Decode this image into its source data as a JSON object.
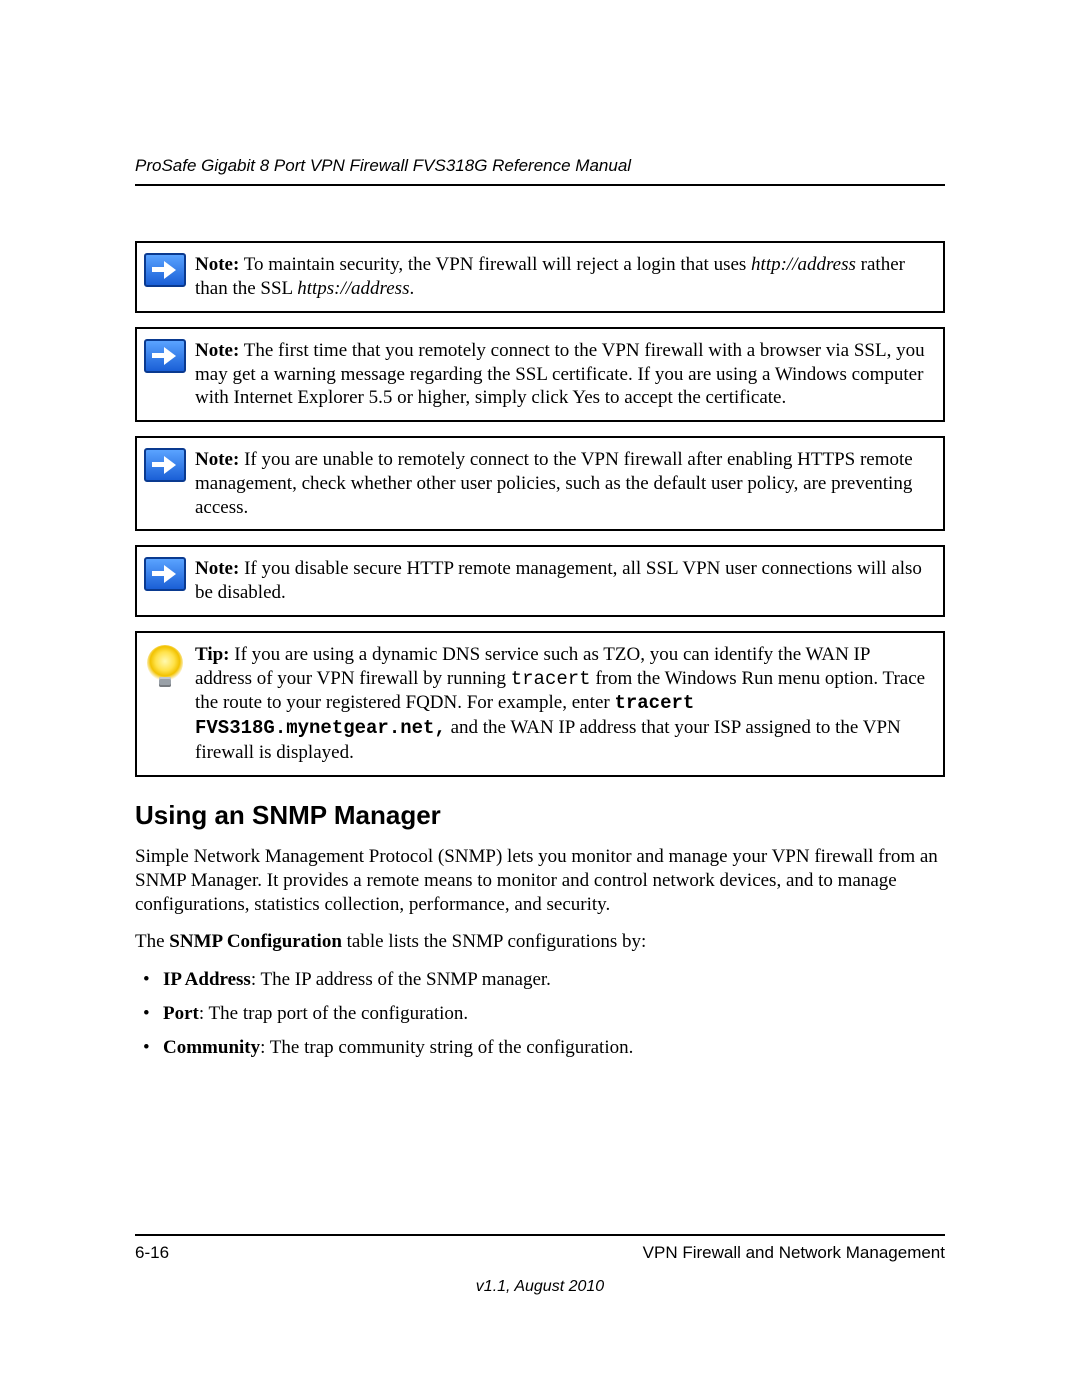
{
  "header": {
    "title": "ProSafe Gigabit 8 Port VPN Firewall FVS318G Reference Manual"
  },
  "notes": [
    {
      "label": "Note:",
      "pre": " To maintain security, the VPN firewall will reject a login that uses ",
      "ital1": "http://address",
      "mid": " rather than the SSL ",
      "ital2": "https://address",
      "post": "."
    },
    {
      "label": "Note:",
      "text": " The first time that you remotely connect to the VPN firewall with a browser via SSL, you may get a warning message regarding the SSL certificate. If you are using a Windows computer with Internet Explorer 5.5 or higher, simply click Yes to accept the certificate."
    },
    {
      "label": "Note:",
      "text": " If you are unable to remotely connect to the VPN firewall after enabling HTTPS remote management, check whether other user policies, such as the default user policy, are preventing access."
    },
    {
      "label": "Note:",
      "text": " If you disable secure HTTP remote management, all SSL VPN user connections will also be disabled."
    }
  ],
  "tip": {
    "label": "Tip:",
    "pre": " If you are using a dynamic DNS service such as TZO, you can identify the WAN IP address of your VPN firewall by running ",
    "mono1": "tracert",
    "mid": " from the Windows Run menu option. Trace the route to your registered FQDN. For example, enter ",
    "monob": "tracert FVS318G.mynetgear.net,",
    "post": " and the WAN IP address that your ISP assigned to the VPN firewall is displayed."
  },
  "section": {
    "heading": "Using an SNMP Manager",
    "para1": "Simple Network Management Protocol (SNMP) lets you monitor and manage your VPN firewall from an SNMP Manager. It provides a remote means to monitor and control network devices, and to manage configurations, statistics collection, performance, and security.",
    "para2_pre": "The ",
    "para2_bold": "SNMP Configuration",
    "para2_post": " table lists the SNMP configurations by:",
    "bullets": [
      {
        "bold": "IP Address",
        "rest": ": The IP address of the SNMP manager."
      },
      {
        "bold": "Port",
        "rest": ": The trap port of the configuration."
      },
      {
        "bold": "Community",
        "rest": ": The trap community string of the configuration."
      }
    ]
  },
  "footer": {
    "left": "6-16",
    "right": "VPN Firewall and Network Management",
    "version": "v1.1, August 2010"
  }
}
